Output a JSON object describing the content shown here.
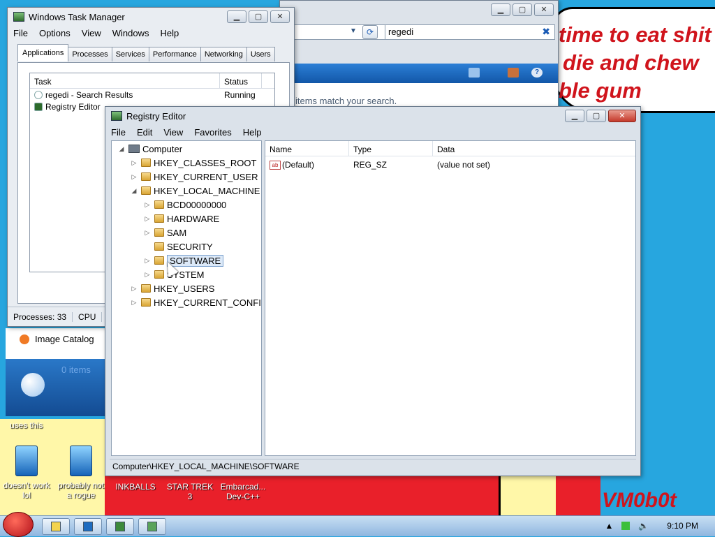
{
  "desktop": {
    "cloud_lines": [
      "time to eat shit",
      "die and chew",
      "ble gum"
    ],
    "signature": "VM0b0t",
    "uses_this": "uses this",
    "icons": [
      {
        "label": "doesn't work lol",
        "icon": "app-icon"
      },
      {
        "label": "probably not a rogue",
        "icon": "app-icon"
      },
      {
        "label": "INKBALLS",
        "icon": "none"
      },
      {
        "label": "STAR TREK 3",
        "icon": "none"
      },
      {
        "label": "Embarcad... Dev-C++",
        "icon": "none"
      }
    ]
  },
  "search_window": {
    "search_value": "regedi",
    "message": "items match your search."
  },
  "task_manager": {
    "title": "Windows Task Manager",
    "menu": [
      "File",
      "Options",
      "View",
      "Windows",
      "Help"
    ],
    "tabs": [
      "Applications",
      "Processes",
      "Services",
      "Performance",
      "Networking",
      "Users"
    ],
    "columns": [
      "Task",
      "Status"
    ],
    "tasks": [
      {
        "name": "regedi - Search Results",
        "status": "Running"
      },
      {
        "name": "Registry Editor",
        "status": ""
      }
    ],
    "status": {
      "processes": "Processes: 33",
      "cpu": "CPU"
    }
  },
  "image_catalog": {
    "label": "Image Catalog",
    "count": "0 items"
  },
  "registry_editor": {
    "title": "Registry Editor",
    "menu": [
      "File",
      "Edit",
      "View",
      "Favorites",
      "Help"
    ],
    "tree": {
      "root": "Computer",
      "hives": [
        "HKEY_CLASSES_ROOT",
        "HKEY_CURRENT_USER",
        "HKEY_LOCAL_MACHINE"
      ],
      "hklm_children": [
        "BCD00000000",
        "HARDWARE",
        "SAM",
        "SECURITY",
        "SOFTWARE",
        "SYSTEM"
      ],
      "more_hives": [
        "HKEY_USERS",
        "HKEY_CURRENT_CONFIG"
      ],
      "selected": "SOFTWARE"
    },
    "columns": [
      "Name",
      "Type",
      "Data"
    ],
    "values": [
      {
        "name": "(Default)",
        "type": "REG_SZ",
        "data": "(value not set)"
      }
    ],
    "status_path": "Computer\\HKEY_LOCAL_MACHINE\\SOFTWARE"
  },
  "taskbar": {
    "clock": "9:10 PM"
  },
  "colors": {
    "desktop_blue": "#27a6df",
    "desktop_red": "#e9202a",
    "cloud_text": "#d0141c"
  }
}
